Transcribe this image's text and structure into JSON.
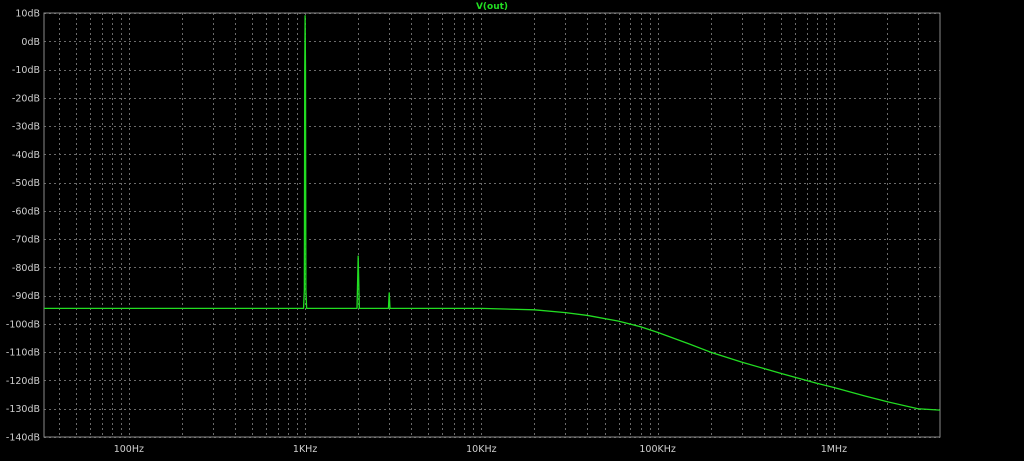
{
  "chart_data": {
    "type": "line",
    "title": "V(out)",
    "xscale": "log",
    "xlim": [
      33,
      4000000
    ],
    "ylim": [
      -140,
      10
    ],
    "grid": true,
    "xlabel": "",
    "ylabel": "",
    "x_ticks": [
      {
        "value": 100,
        "label": "100Hz"
      },
      {
        "value": 1000,
        "label": "1KHz"
      },
      {
        "value": 10000,
        "label": "10KHz"
      },
      {
        "value": 100000,
        "label": "100KHz"
      },
      {
        "value": 1000000,
        "label": "1MHz"
      }
    ],
    "y_ticks": [
      {
        "value": 10,
        "label": "10dB"
      },
      {
        "value": 0,
        "label": "0dB"
      },
      {
        "value": -10,
        "label": "-10dB"
      },
      {
        "value": -20,
        "label": "-20dB"
      },
      {
        "value": -30,
        "label": "-30dB"
      },
      {
        "value": -40,
        "label": "-40dB"
      },
      {
        "value": -50,
        "label": "-50dB"
      },
      {
        "value": -60,
        "label": "-60dB"
      },
      {
        "value": -70,
        "label": "-70dB"
      },
      {
        "value": -80,
        "label": "-80dB"
      },
      {
        "value": -90,
        "label": "-90dB"
      },
      {
        "value": -100,
        "label": "-100dB"
      },
      {
        "value": -110,
        "label": "-110dB"
      },
      {
        "value": -120,
        "label": "-120dB"
      },
      {
        "value": -130,
        "label": "-130dB"
      },
      {
        "value": -140,
        "label": "-140dB"
      }
    ],
    "series": [
      {
        "name": "V(out)",
        "color": "#22dd22",
        "points": [
          [
            33,
            -94.5
          ],
          [
            500,
            -94.5
          ],
          [
            980,
            -94.5
          ],
          [
            990,
            -88
          ],
          [
            995,
            -10
          ],
          [
            1000,
            9
          ],
          [
            1005,
            -10
          ],
          [
            1010,
            -88
          ],
          [
            1020,
            -94.5
          ],
          [
            1970,
            -94.5
          ],
          [
            2000,
            -76
          ],
          [
            2030,
            -94.5
          ],
          [
            2970,
            -94.5
          ],
          [
            3000,
            -89
          ],
          [
            3030,
            -94.5
          ],
          [
            10000,
            -94.5
          ],
          [
            20000,
            -95
          ],
          [
            30000,
            -96
          ],
          [
            40000,
            -97
          ],
          [
            60000,
            -99
          ],
          [
            80000,
            -101
          ],
          [
            100000,
            -103
          ],
          [
            150000,
            -107
          ],
          [
            200000,
            -110
          ],
          [
            300000,
            -113.5
          ],
          [
            500000,
            -117.5
          ],
          [
            800000,
            -121
          ],
          [
            1000000,
            -122.5
          ],
          [
            1500000,
            -125.5
          ],
          [
            2000000,
            -127.5
          ],
          [
            3000000,
            -130
          ],
          [
            4000000,
            -130.5
          ]
        ]
      }
    ]
  }
}
